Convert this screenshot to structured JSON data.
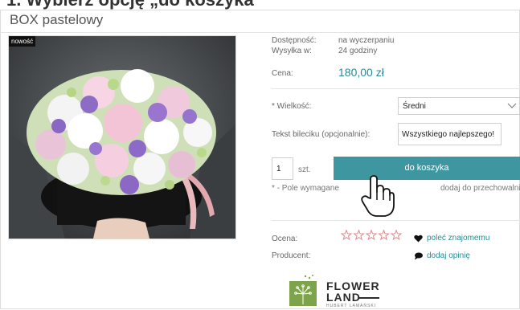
{
  "page_heading": "1. Wybierz opcję „do koszyka”",
  "product": {
    "title": "BOX pastelowy",
    "badge": "nowość"
  },
  "info": {
    "availability_label": "Dostępność:",
    "availability_value": "na wyczerpaniu",
    "shipping_label": "Wysyłka w:",
    "shipping_value": "24 godziny",
    "price_label": "Cena:",
    "price_value": "180,00 zł"
  },
  "options": {
    "size_label": "* Wielkość:",
    "size_selected": "Średni",
    "ticket_label": "Tekst bileciku (opcjonalnie):",
    "ticket_value": "Wszystkiego najlepszego!"
  },
  "cart": {
    "quantity": "1",
    "unit": "szt.",
    "add_button": "do koszyka",
    "required_note": "* - Pole wymagane",
    "storage_link": "dodaj do przechowalni"
  },
  "meta": {
    "rating_label": "Ocena:",
    "rating_value": 0,
    "rating_max": 5,
    "producer_label": "Producent:",
    "recommend_link": "poleć znajomemu",
    "review_link": "dodaj opinię"
  },
  "brand": {
    "name_line1": "FLOWER",
    "name_line2": "LAND",
    "tagline": "HUBERT LAMAŃSKI",
    "logo_color": "#7da44a"
  },
  "colors": {
    "accent": "#3d96a0",
    "price": "#2a8a92",
    "star": "#e08a8a"
  }
}
